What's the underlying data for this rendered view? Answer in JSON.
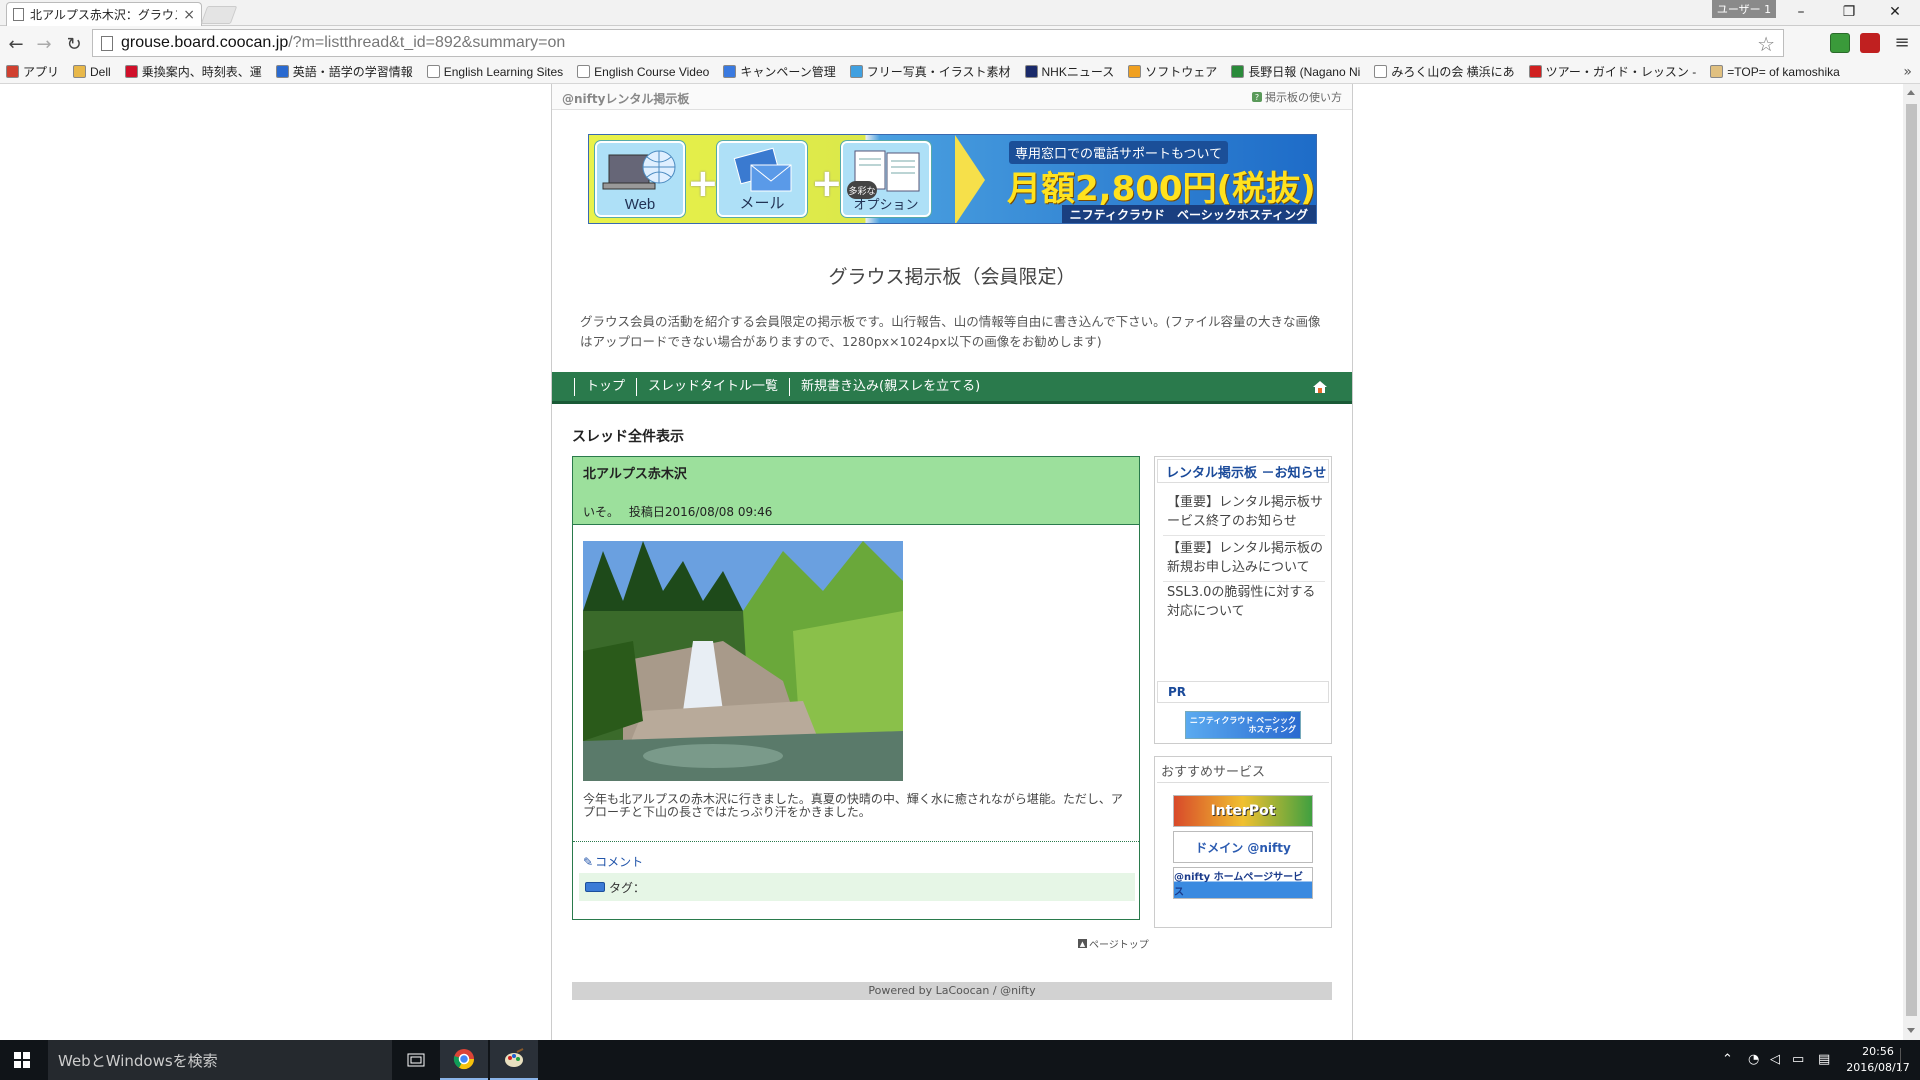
{
  "browser": {
    "tab_title": "北アルプス赤木沢：グラウス",
    "tab_close": "×",
    "user_chip": "ユーザー 1",
    "win_min": "–",
    "win_max": "❐",
    "win_close": "✕",
    "url_host": "grouse.board.coocan.jp",
    "url_path": "/?m=listthread&t_id=892&summary=on",
    "bookmarks": [
      {
        "label": "アプリ",
        "color": "#d04030"
      },
      {
        "label": "Dell",
        "color": "#e8b84a"
      },
      {
        "label": "乗換案内、時刻表、運",
        "color": "#d0102a"
      },
      {
        "label": "英語・語学の学習情報",
        "color": "#2a6ad0"
      },
      {
        "label": "English Learning Sites",
        "color": "#ffffff"
      },
      {
        "label": "English Course Video",
        "color": "#ffffff"
      },
      {
        "label": "キャンペーン管理",
        "color": "#3a7ae0"
      },
      {
        "label": "フリー写真・イラスト素材",
        "color": "#40a0e0"
      },
      {
        "label": "NHKニュース",
        "color": "#1a2a6a"
      },
      {
        "label": "ソフトウェア",
        "color": "#f0a020"
      },
      {
        "label": "長野日報 (Nagano Ni",
        "color": "#2a8a3a"
      },
      {
        "label": "みろく山の会 横浜にあ",
        "color": "#ffffff"
      },
      {
        "label": "ツアー・ガイド・レッスン - ",
        "color": "#d02020"
      },
      {
        "label": "=TOP= of kamoshika",
        "color": "#e0c080"
      }
    ],
    "bookmarks_more": "»"
  },
  "site": {
    "brand": "@niftyレンタル掲示板",
    "help": "掲示板の使い方"
  },
  "banner": {
    "tile1": "Web",
    "tile2": "メール",
    "tile3": "オプション",
    "tile3_badge": "多彩な",
    "phone_note": "専用窓口での電話サポートもついて",
    "price": "月額2,800円(税抜)〜",
    "footer": "ニフティクラウド　ベーシックホスティング"
  },
  "board": {
    "title": "グラウス掲示板（会員限定）",
    "description": "グラウス会員の活動を紹介する会員限定の掲示板です。山行報告、山の情報等自由に書き込んで下さい。(ファイル容量の大きな画像はアップロードできない場合がありますので、1280px×1024px以下の画像をお勧めします)"
  },
  "nav": {
    "items": [
      "トップ",
      "スレッドタイトル一覧",
      "新規書き込み(親スレを立てる)"
    ]
  },
  "section_title": "スレッド全件表示",
  "post": {
    "title": "北アルプス赤木沢",
    "author": "いそ。",
    "date_label": "投稿日",
    "date": "2016/08/08 09:46",
    "body": "今年も北アルプスの赤木沢に行きました。真夏の快晴の中、輝く水に癒されながら堪能。ただし、アプローチと下山の長さではたっぷり汗をかきました。",
    "comment": "コメント",
    "tag_label": "タグ："
  },
  "page_top": "ページトップ",
  "sidebar": {
    "notice_title": "レンタル掲示板 －お知らせ",
    "notices": [
      "【重要】レンタル掲示板サービス終了のお知らせ",
      "【重要】レンタル掲示板の新規お申し込みについて",
      "SSL3.0の脆弱性に対する対応について"
    ],
    "pr_title": "PR",
    "pr_ad": "ニフティクラウド ベーシックホスティング",
    "recommend_title": "おすすめサービス",
    "rec_ads": [
      "InterPot",
      "ドメイン @nifty",
      "@nifty ホームページサービス"
    ]
  },
  "footer": "Powered by LaCoocan / @nifty",
  "taskbar": {
    "search": "WebとWindowsを検索",
    "time": "20:56",
    "date": "2016/08/17"
  }
}
